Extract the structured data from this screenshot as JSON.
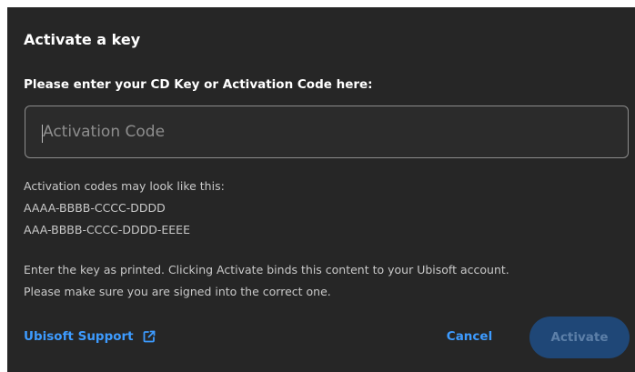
{
  "dialog": {
    "title": "Activate a key",
    "prompt": "Please enter your CD Key or Activation Code here:",
    "code_input": {
      "placeholder": "Activation Code",
      "value": ""
    },
    "format_hint": {
      "intro": "Activation codes may look like this:",
      "examples": [
        "AAAA-BBBB-CCCC-DDDD",
        "AAA-BBBB-CCCC-DDDD-EEEE"
      ]
    },
    "notice_lines": [
      "Enter the key as printed. Clicking Activate binds this content to your Ubisoft account.",
      "Please make sure you are signed into the correct one."
    ],
    "support_link": {
      "label": "Ubisoft Support",
      "icon": "external-link-icon"
    },
    "buttons": {
      "cancel_label": "Cancel",
      "activate_label": "Activate",
      "activate_enabled": false
    }
  },
  "colors": {
    "dialog_background": "#262626",
    "accent_link": "#3d9bff",
    "primary_disabled_bg": "#1f4777",
    "primary_disabled_text": "#5c7fa8",
    "input_border": "#8c8c8c"
  }
}
